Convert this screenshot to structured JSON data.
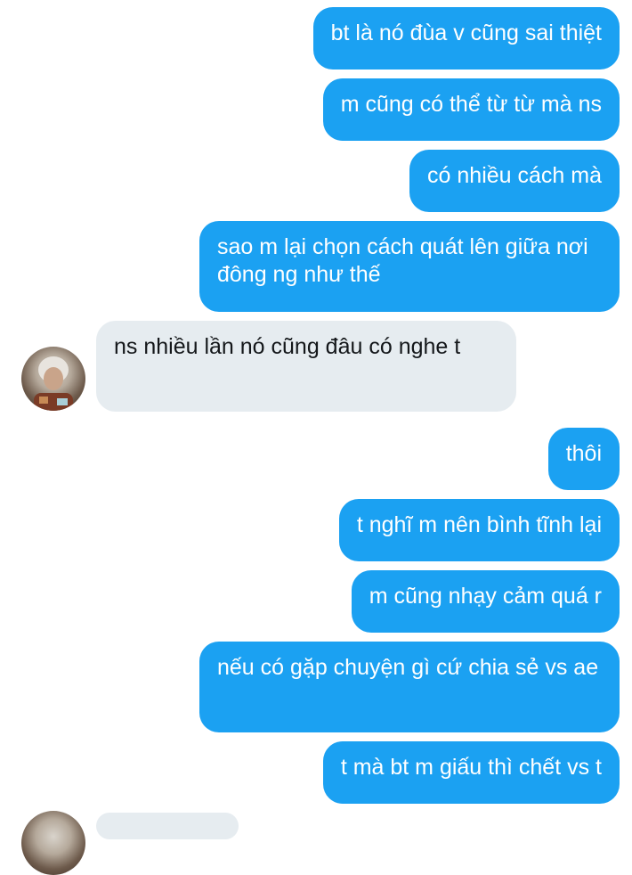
{
  "colors": {
    "sent_bubble": "#1ba1f2",
    "received_bubble": "#e6ecf0",
    "sent_text": "#ffffff",
    "received_text": "#14171a"
  },
  "messages": [
    {
      "direction": "sent",
      "text": "bt là nó đùa v cũng sai thiệt"
    },
    {
      "direction": "sent",
      "text": "m cũng có thể từ từ mà ns"
    },
    {
      "direction": "sent",
      "text": "có nhiều cách mà"
    },
    {
      "direction": "sent",
      "text": "sao m lại chọn cách quát lên giữa nơi đông ng như thế"
    },
    {
      "direction": "received",
      "text": "ns nhiều lần nó cũng đâu có nghe t"
    },
    {
      "direction": "sent",
      "text": "thôi"
    },
    {
      "direction": "sent",
      "text": "t nghĩ m nên bình tĩnh lại"
    },
    {
      "direction": "sent",
      "text": "m cũng nhạy cảm quá r"
    },
    {
      "direction": "sent",
      "text": "nếu có gặp chuyện gì cứ chia sẻ vs ae"
    },
    {
      "direction": "sent",
      "text": "t mà bt m giấu thì chết vs t"
    }
  ]
}
